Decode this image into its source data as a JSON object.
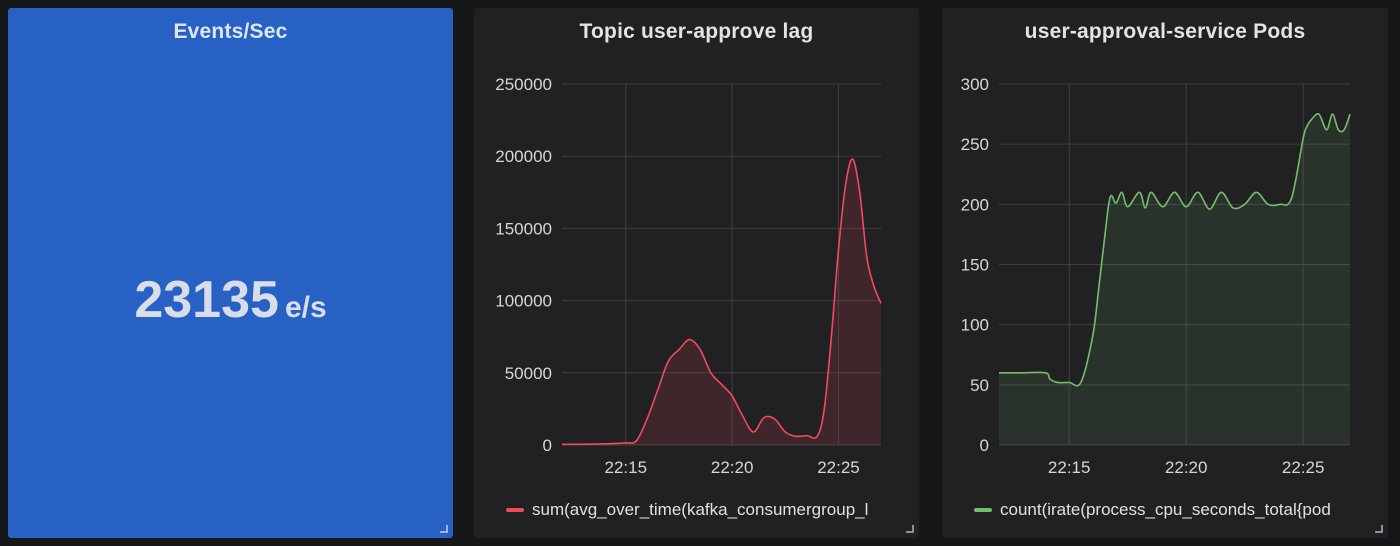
{
  "panels": {
    "events": {
      "title": "Events/Sec",
      "value": "23135",
      "unit": "e/s"
    },
    "lag": {
      "title": "Topic user-approve lag",
      "legend": "sum(avg_over_time(kafka_consumergroup_l"
    },
    "pods": {
      "title": "user-approval-service Pods",
      "legend": "count(irate(process_cpu_seconds_total{pod"
    }
  },
  "colors": {
    "lag_line": "#f2495c",
    "pods_line": "#73bf69",
    "stat_bg": "#2761c4"
  },
  "chart_data": [
    {
      "type": "area",
      "title": "Topic user-approve lag",
      "x_unit": "time (HH:MM)",
      "x_ticks": [
        "22:15",
        "22:20",
        "22:25"
      ],
      "x_range": [
        "22:12",
        "22:27"
      ],
      "y_ticks": [
        0,
        50000,
        100000,
        150000,
        200000,
        250000
      ],
      "ylim": [
        0,
        250000
      ],
      "grid": true,
      "legend_position": "bottom",
      "series": [
        {
          "name": "sum(avg_over_time(kafka_consumergroup_l",
          "color": "#f2495c",
          "x": [
            "22:12",
            "22:13",
            "22:14",
            "22:15",
            "22:15:30",
            "22:16",
            "22:16:30",
            "22:17",
            "22:17:30",
            "22:18",
            "22:18:30",
            "22:19",
            "22:19:30",
            "22:20",
            "22:20:30",
            "22:21",
            "22:21:30",
            "22:22",
            "22:22:30",
            "22:23",
            "22:23:30",
            "22:24",
            "22:24:20",
            "22:24:40",
            "22:25",
            "22:25:20",
            "22:25:40",
            "22:26",
            "22:26:20",
            "22:26:40",
            "22:27"
          ],
          "y": [
            500,
            500,
            800,
            1500,
            3000,
            18000,
            38000,
            58000,
            66000,
            73000,
            66000,
            50000,
            42000,
            34000,
            20000,
            9000,
            19000,
            18000,
            9000,
            6000,
            6500,
            6000,
            25000,
            75000,
            135000,
            180000,
            198000,
            175000,
            130000,
            110000,
            98000
          ]
        }
      ]
    },
    {
      "type": "area",
      "title": "user-approval-service Pods",
      "x_unit": "time (HH:MM)",
      "x_ticks": [
        "22:15",
        "22:20",
        "22:25"
      ],
      "x_range": [
        "22:12",
        "22:27"
      ],
      "y_ticks": [
        0,
        50,
        100,
        150,
        200,
        250,
        300
      ],
      "ylim": [
        0,
        300
      ],
      "grid": true,
      "legend_position": "bottom",
      "series": [
        {
          "name": "count(irate(process_cpu_seconds_total{pod",
          "color": "#73bf69",
          "x": [
            "22:12",
            "22:13",
            "22:14",
            "22:14:10",
            "22:14:30",
            "22:15",
            "22:15:30",
            "22:16",
            "22:16:15",
            "22:16:30",
            "22:16:45",
            "22:17",
            "22:17:15",
            "22:17:30",
            "22:18",
            "22:18:15",
            "22:18:30",
            "22:19",
            "22:19:30",
            "22:20",
            "22:20:30",
            "22:21",
            "22:21:30",
            "22:22",
            "22:22:30",
            "22:23",
            "22:23:30",
            "22:24",
            "22:24:30",
            "22:25",
            "22:25:10",
            "22:25:20",
            "22:25:40",
            "22:26",
            "22:26:15",
            "22:26:30",
            "22:26:45",
            "22:27"
          ],
          "y": [
            60,
            60,
            60,
            55,
            52,
            52,
            52,
            90,
            128,
            170,
            206,
            201,
            210,
            198,
            210,
            197,
            210,
            198,
            210,
            198,
            210,
            196,
            210,
            197,
            200,
            210,
            200,
            200,
            205,
            255,
            265,
            270,
            275,
            262,
            275,
            262,
            262,
            275
          ]
        }
      ]
    }
  ]
}
